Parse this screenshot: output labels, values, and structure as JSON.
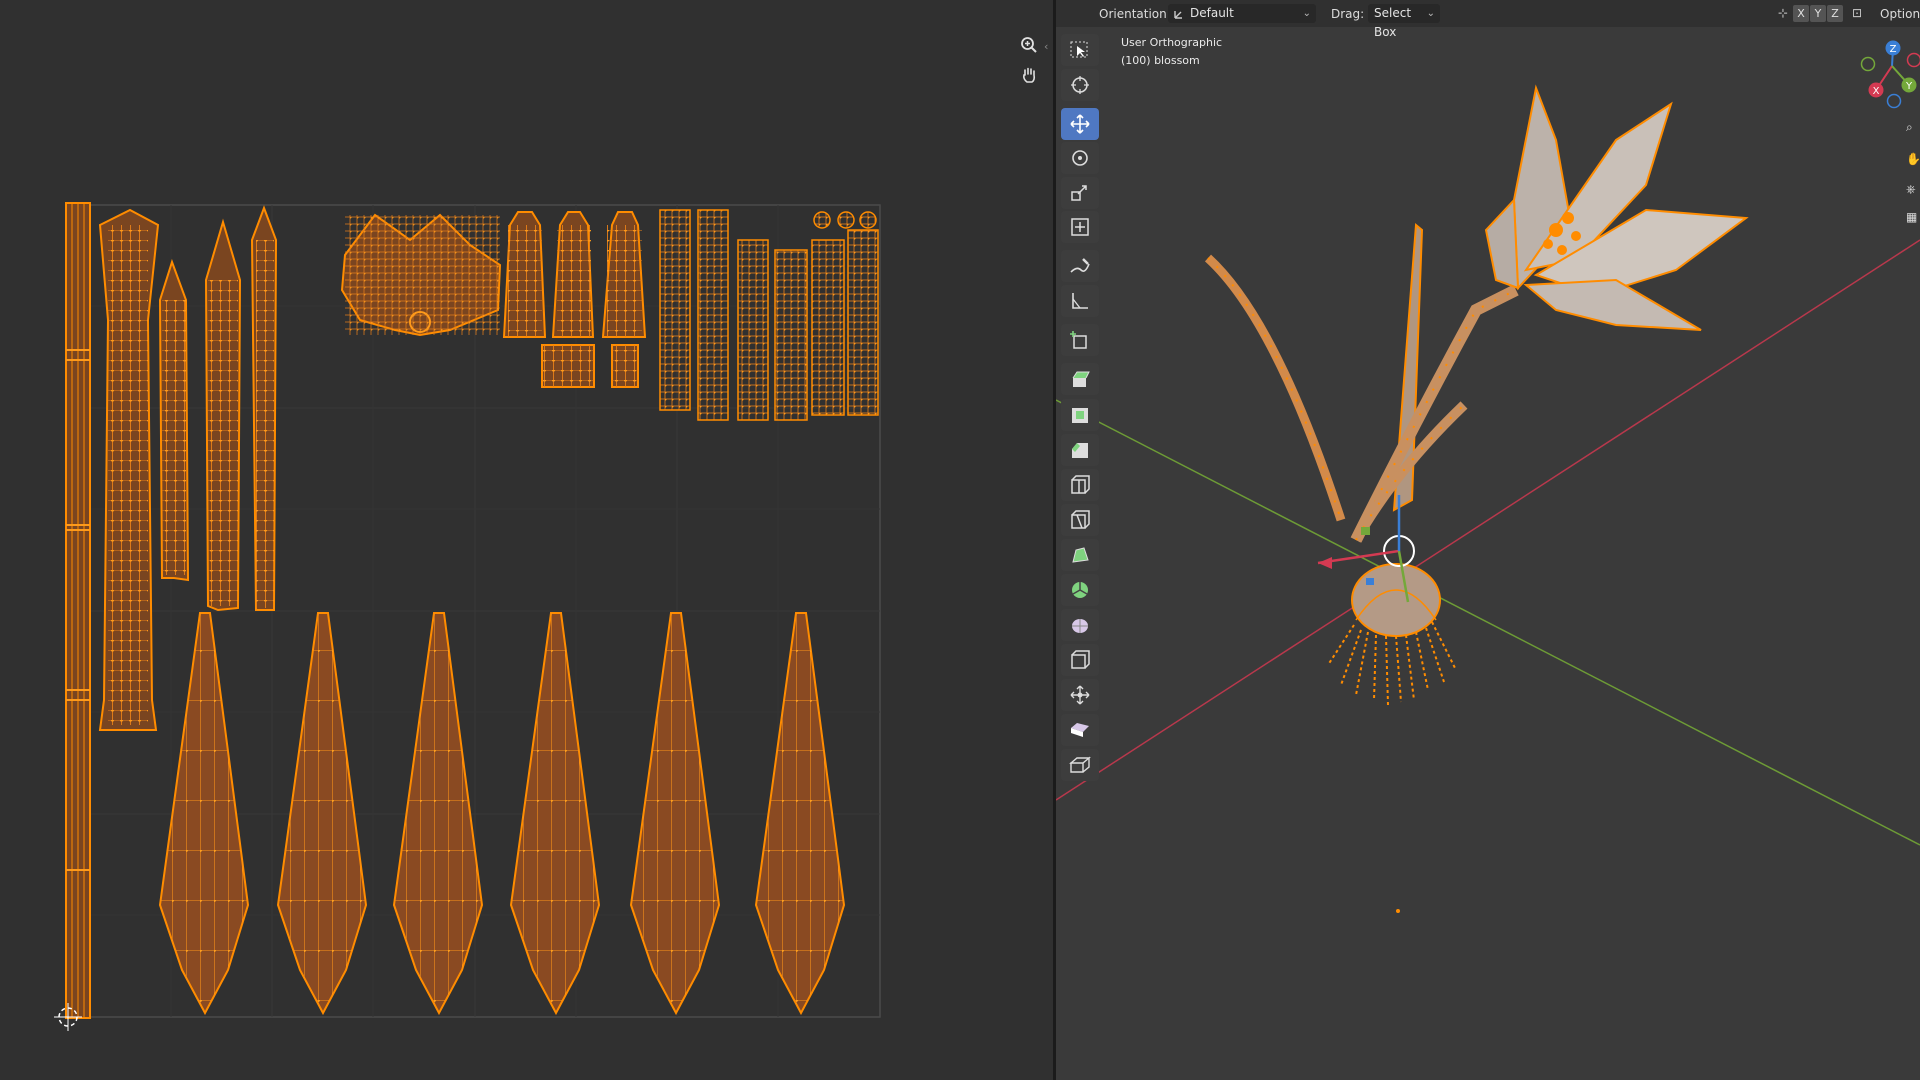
{
  "uv_editor": {
    "zoom_icon": "zoom-in-icon",
    "pan_icon": "hand-icon",
    "collapse_glyph": "‹"
  },
  "viewport": {
    "header": {
      "orientation_label": "Orientation:",
      "orientation_value": "Default",
      "drag_label": "Drag:",
      "drag_value": "Select Box",
      "axis_buttons": [
        "X",
        "Y",
        "Z"
      ],
      "options_label": "Options"
    },
    "overlay": {
      "view_name": "User Orthographic",
      "object_info": "(100) blossom"
    },
    "gizmo": {
      "x_label": "X",
      "y_label": "Y",
      "z_label": "Z"
    },
    "tools": [
      {
        "name": "select-box",
        "icon": "select-box-icon",
        "active": false
      },
      {
        "name": "cursor",
        "icon": "cursor-icon",
        "active": false
      },
      {
        "name": "move",
        "icon": "move-icon",
        "active": true
      },
      {
        "name": "rotate",
        "icon": "rotate-icon",
        "active": false
      },
      {
        "name": "scale",
        "icon": "scale-icon",
        "active": false
      },
      {
        "name": "transform",
        "icon": "transform-icon",
        "active": false
      },
      {
        "name": "annotate",
        "icon": "annotate-icon",
        "active": false
      },
      {
        "name": "measure",
        "icon": "measure-icon",
        "active": false
      },
      {
        "name": "add-cube",
        "icon": "add-cube-icon",
        "active": false
      },
      {
        "name": "extrude",
        "icon": "extrude-icon",
        "active": false
      },
      {
        "name": "inset",
        "icon": "inset-icon",
        "active": false
      },
      {
        "name": "bevel",
        "icon": "bevel-icon",
        "active": false
      },
      {
        "name": "loop-cut",
        "icon": "loop-cut-icon",
        "active": false
      },
      {
        "name": "knife",
        "icon": "knife-icon",
        "active": false
      },
      {
        "name": "poly-build",
        "icon": "poly-build-icon",
        "active": false
      },
      {
        "name": "spin",
        "icon": "spin-icon",
        "active": false
      },
      {
        "name": "smooth",
        "icon": "smooth-icon",
        "active": false
      },
      {
        "name": "edge-slide",
        "icon": "edge-slide-icon",
        "active": false
      },
      {
        "name": "shrink-fatten",
        "icon": "shrink-fatten-icon",
        "active": false
      },
      {
        "name": "shear",
        "icon": "shear-icon",
        "active": false
      },
      {
        "name": "rip-region",
        "icon": "rip-region-icon",
        "active": false
      }
    ]
  },
  "colors": {
    "uv_background": "#303030",
    "viewport_background": "#3a3a3a",
    "selection_orange": "#ff8c00",
    "uv_face_fill": "#8a4a22",
    "active_tool": "#4f78c2",
    "x_axis": "#d43a52",
    "y_axis": "#74a83a",
    "z_axis": "#3a7fd6"
  }
}
